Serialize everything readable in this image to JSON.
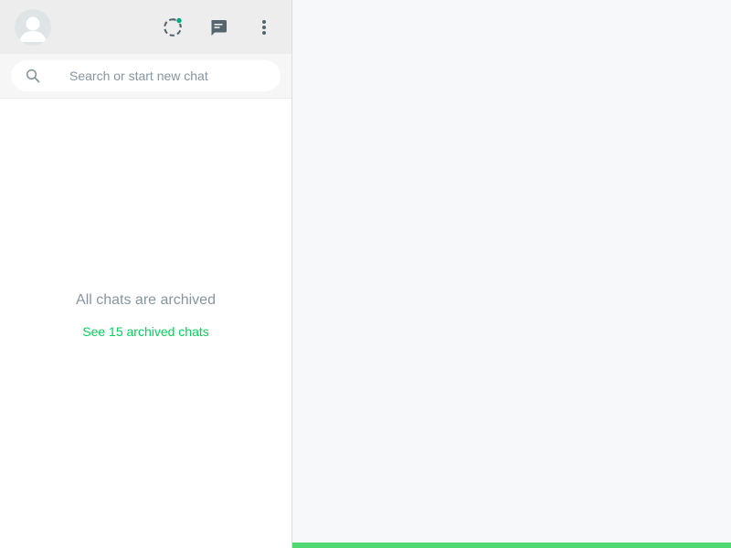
{
  "sidebar": {
    "header": {
      "avatar_icon": "default-user-avatar",
      "icons": [
        "status-icon",
        "new-chat-icon",
        "menu-icon"
      ]
    },
    "search": {
      "placeholder": "Search or start new chat",
      "value": ""
    },
    "empty_state": {
      "title": "All chats are archived",
      "link": "See 15 archived chats"
    }
  },
  "colors": {
    "accent": "#06cf5c",
    "status_dot": "#00a884",
    "bottom_bar": "#52d873"
  }
}
